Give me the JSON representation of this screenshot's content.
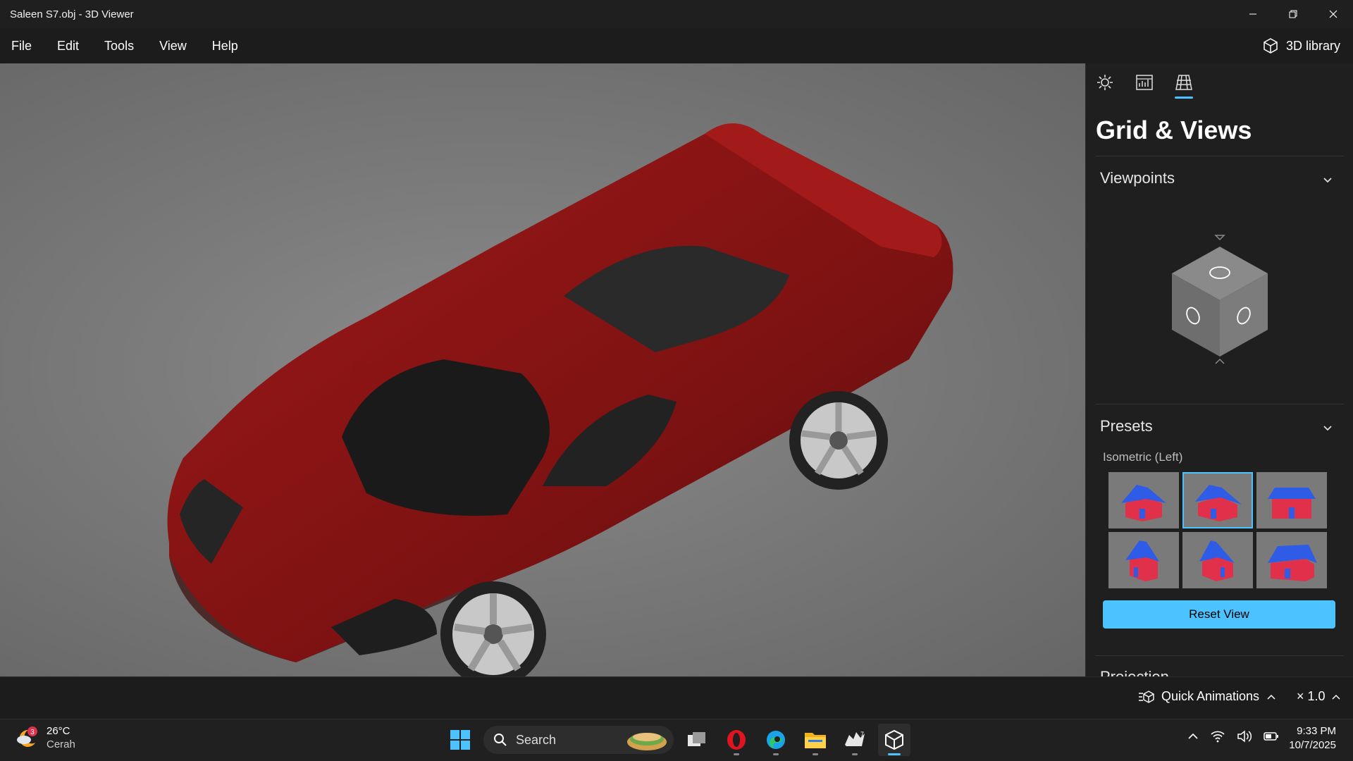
{
  "window": {
    "title": "Saleen S7.obj - 3D Viewer"
  },
  "menu": {
    "items": [
      "File",
      "Edit",
      "Tools",
      "View",
      "Help"
    ],
    "library": "3D library"
  },
  "panel": {
    "title": "Grid & Views",
    "tabs": [
      "sun-icon",
      "stats-icon",
      "grid-icon"
    ],
    "active_tab": "grid-icon",
    "viewpoints": "Viewpoints",
    "presets": "Presets",
    "preset_label": "Isometric (Left)",
    "selected_preset": 1,
    "reset": "Reset View",
    "projection": "Projection"
  },
  "status": {
    "quick_animations": "Quick Animations",
    "speed": "× 1.0"
  },
  "taskbar": {
    "weather_badge": "3",
    "temperature": "26°C",
    "condition": "Cerah",
    "search": "Search",
    "time": "9:33 PM",
    "date": "10/7/2025"
  },
  "colors": {
    "accent": "#4cc2ff",
    "car": "#8b1414",
    "roof": "#2e5ce6",
    "wall": "#e0304a"
  }
}
